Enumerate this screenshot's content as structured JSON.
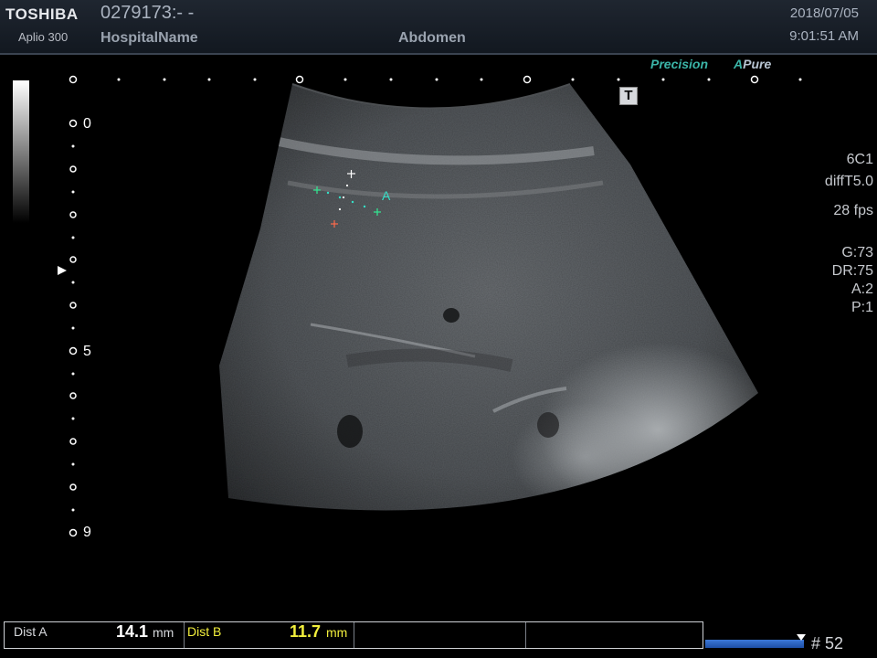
{
  "header": {
    "brand": "TOSHIBA",
    "model": "Aplio 300",
    "patient_id": "0279173:- -",
    "hospital": "HospitalName",
    "exam": "Abdomen",
    "date": "2018/07/05",
    "time": "9:01:51 AM"
  },
  "modes": {
    "precision": "Precision",
    "apure_a": "A",
    "apure_pure": "Pure"
  },
  "probe": {
    "name": "6C1",
    "preset": "diffT5.0",
    "fps": "28 fps"
  },
  "params": {
    "gain": "G:73",
    "dr": "DR:75",
    "a": "A:2",
    "p": "P:1"
  },
  "t_icon": "T",
  "depth": {
    "top": "0",
    "mid": "5",
    "bottom": "9"
  },
  "caliper_label": "A",
  "measurements": {
    "dist_a_label": "Dist A",
    "dist_a_value": "14.1",
    "dist_a_unit": "mm",
    "dist_b_label": "Dist B",
    "dist_b_value": "11.7",
    "dist_b_unit": "mm"
  },
  "frame": "# 52",
  "colors": {
    "accent_teal": "#3bb5a8",
    "dist_b_yellow": "#f2ef3c",
    "caliper_green": "#35e08f",
    "caliper_red": "#ff6a4a"
  },
  "icons": [
    "gray-scale-bar",
    "t-icon",
    "depth-marker-icon",
    "caliper-cross-icon",
    "frame-marker-icon"
  ]
}
